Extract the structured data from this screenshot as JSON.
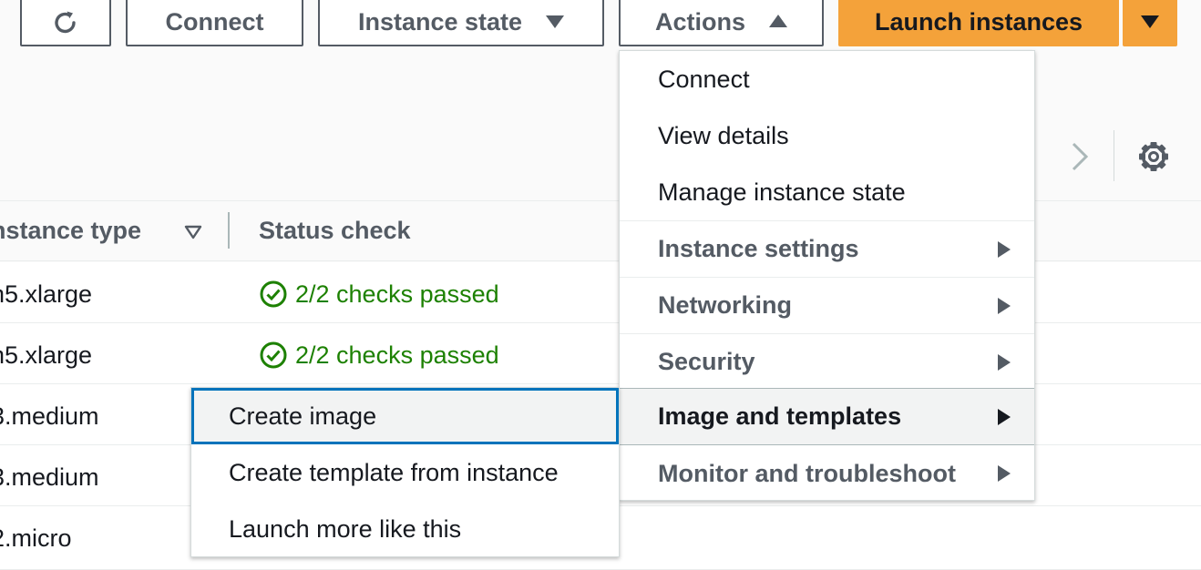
{
  "toolbar": {
    "connect_label": "Connect",
    "instance_state_label": "Instance state",
    "actions_label": "Actions",
    "launch_label": "Launch instances"
  },
  "table": {
    "columns": [
      "nstance type",
      "Status check"
    ],
    "rows": [
      {
        "type": "n5.xlarge",
        "status": "2/2 checks passed"
      },
      {
        "type": "n5.xlarge",
        "status": "2/2 checks passed"
      },
      {
        "type": "3.medium",
        "status": ""
      },
      {
        "type": "3.medium",
        "status": ""
      },
      {
        "type": "2.micro",
        "status": ""
      }
    ]
  },
  "actions_menu": {
    "items": [
      {
        "label": "Connect"
      },
      {
        "label": "View details"
      },
      {
        "label": "Manage instance state"
      },
      {
        "label": "Instance settings"
      },
      {
        "label": "Networking"
      },
      {
        "label": "Security"
      },
      {
        "label": "Image and templates"
      },
      {
        "label": "Monitor and troubleshoot"
      }
    ]
  },
  "submenu": {
    "items": [
      {
        "label": "Create image"
      },
      {
        "label": "Create template from instance"
      },
      {
        "label": "Launch more like this"
      }
    ]
  },
  "icons": {
    "refresh": "refresh-icon",
    "settings": "gear-icon",
    "next": "chevron-right-icon",
    "status_ok": "check-circle-icon"
  },
  "colors": {
    "primary": "#f4a23a",
    "success": "#1d8102",
    "focus": "#0073bb"
  }
}
